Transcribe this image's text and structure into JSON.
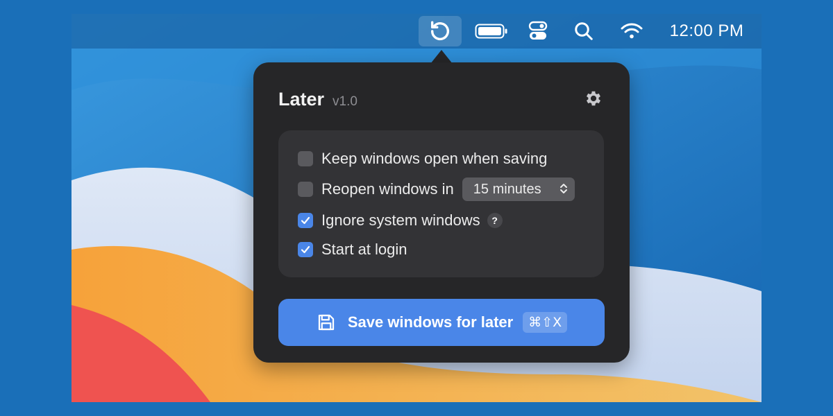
{
  "menubar": {
    "icons": [
      "later-app-icon",
      "battery-icon",
      "control-center-icon",
      "search-icon",
      "wifi-icon"
    ],
    "clock": "12:00 PM"
  },
  "popover": {
    "app_name": "Later",
    "version": "v1.0",
    "options": [
      {
        "label": "Keep windows open when saving",
        "checked": false
      },
      {
        "label": "Reopen windows in",
        "checked": false,
        "select_value": "15 minutes"
      },
      {
        "label": "Ignore system windows",
        "checked": true,
        "help": "?"
      },
      {
        "label": "Start at login",
        "checked": true
      }
    ],
    "save_button": {
      "label": "Save windows for later",
      "shortcut": "⌘⇧X"
    }
  },
  "colors": {
    "accent": "#4a86e8",
    "popover_bg": "#262628",
    "options_bg": "#333336",
    "desktop_blue": "#1a6fb8"
  }
}
